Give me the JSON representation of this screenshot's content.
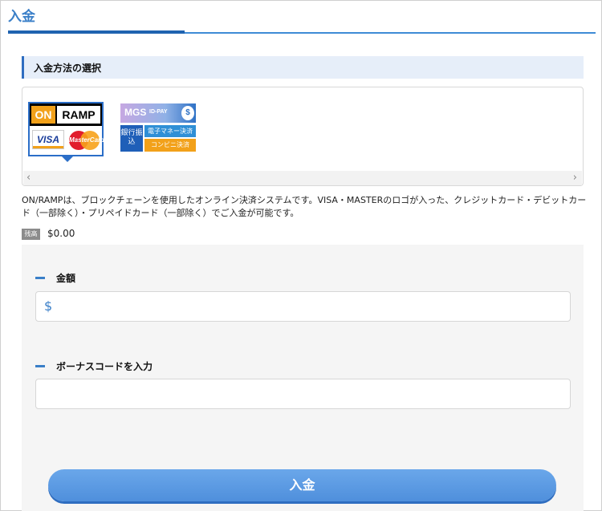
{
  "page": {
    "title": "入金"
  },
  "section": {
    "title": "入金方法の選択"
  },
  "methods": {
    "onramp": {
      "on": "ON",
      "ramp": "RAMP",
      "visa": "VISA",
      "mastercard": "MasterCard"
    },
    "mgs": {
      "name": "MGS",
      "idpay": "ID-PAY",
      "coin": "$",
      "bank": "銀行振込",
      "emoney": "電子マネー決済",
      "convenience": "コンビニ決済"
    },
    "scroll": {
      "left_icon": "chevron-left-icon",
      "right_icon": "chevron-right-icon",
      "left": "‹",
      "right": "›"
    }
  },
  "description": "ON/RAMPは、ブロックチェーンを使用したオンライン決済システムです。VISA・MASTERのロゴが入った、クレジットカード・デビットカード（一部除く）・プリペイドカード（一部除く）でご入金が可能です。",
  "balance": {
    "label": "残高",
    "value": "$0.00"
  },
  "form": {
    "amount_label": "金額",
    "currency_symbol": "$",
    "amount_value": "",
    "bonus_label": "ボーナスコードを入力",
    "bonus_value": ""
  },
  "submit": {
    "label": "入金"
  },
  "colors": {
    "accent": "#3a7fc8",
    "button": "#4f8fdc",
    "header_bg": "#e6eef9"
  }
}
